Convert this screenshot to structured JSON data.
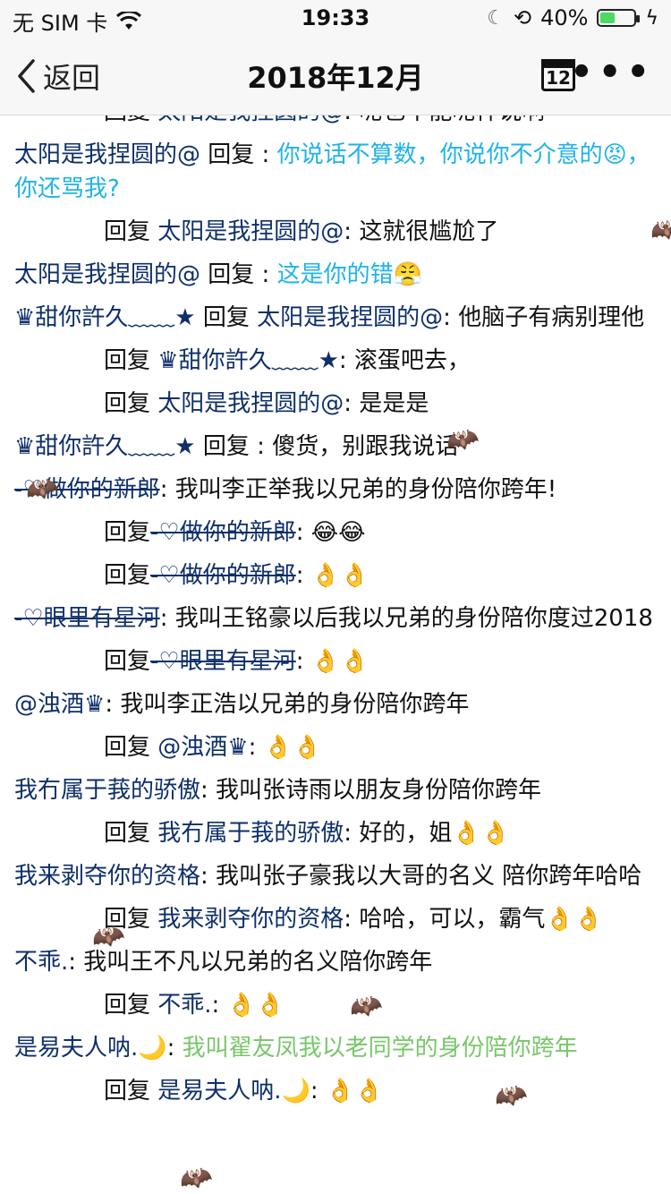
{
  "status_bar": {
    "carrier": "无 SIM 卡",
    "time": "19:33",
    "battery": "40%"
  },
  "nav": {
    "back_label": "返回",
    "title": "2018年12月",
    "calendar_day": "12",
    "more": "•••"
  },
  "comments": [
    {
      "reply": true,
      "pre": "回复 ",
      "name": "太阳是我捏圆的@",
      "sep": ": ",
      "msg": "呢也不能呢样说啊",
      "style": "plain"
    },
    {
      "reply": false,
      "name": "太阳是我捏圆的@",
      "pre2": " 回复 ",
      "sep": ": ",
      "msg": "你说话不算数，你说你不介意的😡，你还骂我?",
      "style": "blue"
    },
    {
      "reply": true,
      "pre": "回复 ",
      "name": "太阳是我捏圆的@",
      "sep": ": ",
      "msg": "这就很尴尬了",
      "style": "plain"
    },
    {
      "reply": false,
      "name": "太阳是我捏圆的@",
      "pre2": " 回复 ",
      "sep": ": ",
      "msg": "这是你的错😤",
      "style": "blue"
    },
    {
      "reply": false,
      "name": "♛甜你許久﹏﹏★",
      "pre2": " 回复 ",
      "name2": "太阳是我捏圆的@",
      "sep": ": ",
      "msg": "他脑子有病别理他",
      "style": "plain"
    },
    {
      "reply": true,
      "pre": "回复 ",
      "name": "♛甜你許久﹏﹏★",
      "sep": ": ",
      "msg": "滚蛋吧去，",
      "style": "plain"
    },
    {
      "reply": true,
      "pre": "回复 ",
      "name": "太阳是我捏圆的@",
      "sep": ": ",
      "msg": "是是是",
      "style": "plain"
    },
    {
      "reply": false,
      "name": "♛甜你許久﹏﹏★",
      "pre2": " 回复 ",
      "sep": ": ",
      "msg": "傻货，别跟我说话",
      "style": "plain"
    },
    {
      "reply": false,
      "name": "-♡做你的新郎",
      "strike": true,
      "sep": ": ",
      "msg": "我叫李正举我以兄弟的身份陪你跨年!",
      "style": "plain"
    },
    {
      "reply": true,
      "pre": "回复",
      "name": "-♡做你的新郎",
      "strike": true,
      "sep": ": ",
      "msg": "😂😂",
      "style": "plain"
    },
    {
      "reply": true,
      "pre": "回复",
      "name": "-♡做你的新郎",
      "strike": true,
      "sep": ": ",
      "msg": "👌👌",
      "style": "plain"
    },
    {
      "reply": false,
      "name": "-♡眼里有星河",
      "strike": true,
      "sep": ": ",
      "msg": "我叫王铭豪以后我以兄弟的身份陪你度过2018",
      "style": "plain"
    },
    {
      "reply": true,
      "pre": "回复",
      "name": "-♡眼里有星河",
      "strike": true,
      "sep": ": ",
      "msg": "👌👌",
      "style": "plain"
    },
    {
      "reply": false,
      "name": "@浊酒♛",
      "sep": ": ",
      "msg": "我叫李正浩以兄弟的身份陪你跨年",
      "style": "plain"
    },
    {
      "reply": true,
      "pre": "回复 ",
      "name": "@浊酒♛",
      "sep": ": ",
      "msg": "👌👌",
      "style": "plain"
    },
    {
      "reply": false,
      "name": "我冇属于莪的骄傲",
      "sep": ": ",
      "msg": "我叫张诗雨以朋友身份陪你跨年",
      "style": "plain"
    },
    {
      "reply": true,
      "pre": "回复 ",
      "name": "我冇属于莪的骄傲",
      "sep": ": ",
      "msg": "好的，姐👌👌",
      "style": "plain"
    },
    {
      "reply": false,
      "name": "我来剥夺你的资格",
      "sep": ": ",
      "msg": "我叫张子豪我以大哥的名义 陪你跨年哈哈",
      "style": "plain"
    },
    {
      "reply": true,
      "pre": "回复 ",
      "name": "我来剥夺你的资格",
      "sep": ": ",
      "msg": "哈哈，可以，霸气👌👌",
      "style": "plain"
    },
    {
      "reply": false,
      "name": "不乖.",
      "sep": ": ",
      "msg": "我叫王不凡以兄弟的名义陪你跨年",
      "style": "plain"
    },
    {
      "reply": true,
      "pre": "回复 ",
      "name": "不乖.",
      "sep": ": ",
      "msg": "👌👌",
      "style": "plain"
    },
    {
      "reply": false,
      "name": "是易夫人呐.🌙",
      "sep": ": ",
      "msg": "我叫翟友凤我以老同学的身份陪你跨年",
      "style": "green"
    },
    {
      "reply": true,
      "pre": "回复 ",
      "name": "是易夫人呐.🌙",
      "sep": ": ",
      "msg": "👌👌",
      "style": "plain"
    }
  ]
}
